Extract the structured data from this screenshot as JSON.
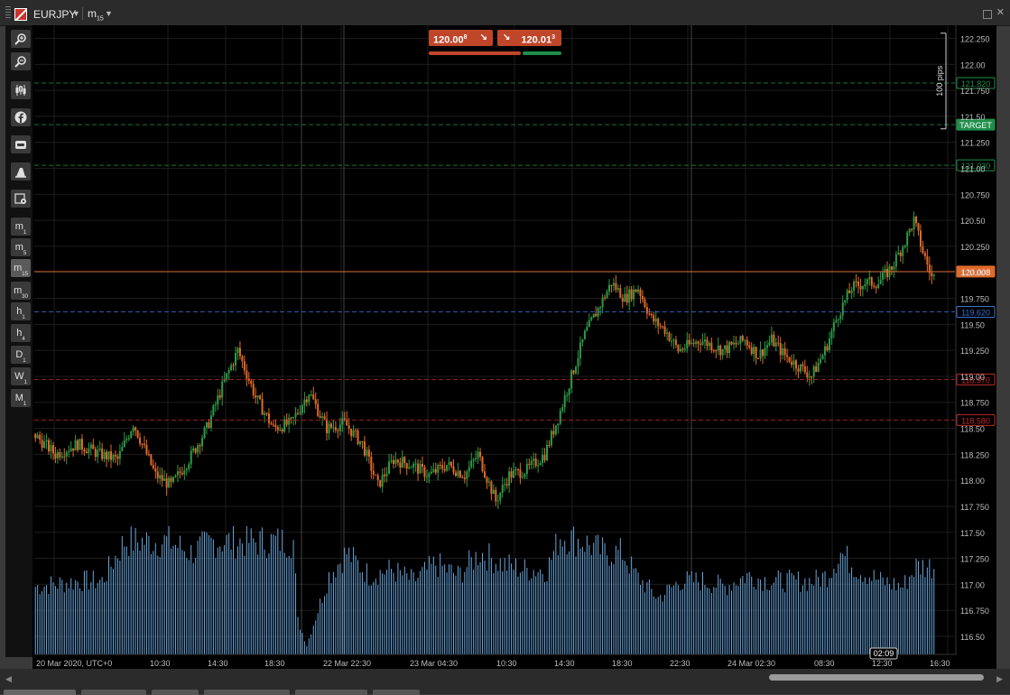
{
  "window": {
    "symbol": "EURJPY",
    "timeframe_main": "m",
    "timeframe_sub": "15"
  },
  "sidebar": {
    "tools": [
      {
        "name": "zoom-in-icon"
      },
      {
        "name": "zoom-out-icon"
      },
      {
        "name": "candlestick-icon"
      },
      {
        "name": "facebook-icon"
      },
      {
        "name": "bot-icon"
      },
      {
        "name": "drawing-icon"
      },
      {
        "name": "settings-icon"
      }
    ],
    "timeframes": [
      {
        "main": "m",
        "sub": "1",
        "active": false
      },
      {
        "main": "m",
        "sub": "5",
        "active": false
      },
      {
        "main": "m",
        "sub": "15",
        "active": true
      },
      {
        "main": "m",
        "sub": "30",
        "active": false
      },
      {
        "main": "h",
        "sub": "1",
        "active": false
      },
      {
        "main": "h",
        "sub": "4",
        "active": false
      },
      {
        "main": "D",
        "sub": "1",
        "active": false
      },
      {
        "main": "W",
        "sub": "1",
        "active": false
      },
      {
        "main": "M",
        "sub": "1",
        "active": false
      }
    ]
  },
  "trade": {
    "sell_price": "120.00",
    "sell_superscript": "8",
    "buy_price": "120.01",
    "buy_superscript": "3",
    "sell_share": 0.7,
    "buy_share": 0.3
  },
  "chart_data": {
    "type": "candlestick",
    "ylim": [
      116.3,
      122.35
    ],
    "y_ticks": [
      "122.250",
      "122.00",
      "121.750",
      "121.50",
      "121.250",
      "121.00",
      "120.750",
      "120.50",
      "120.250",
      "120.00",
      "119.750",
      "119.50",
      "119.250",
      "119.00",
      "118.750",
      "118.50",
      "118.250",
      "118.00",
      "117.750",
      "117.50",
      "117.250",
      "117.00",
      "116.750",
      "116.50"
    ],
    "x_labels": [
      "20 Mar 2020, UTC+0",
      "10:30",
      "14:30",
      "18:30",
      "22 Mar 22:30",
      "23 Mar 04:30",
      "10:30",
      "14:30",
      "18:30",
      "22:30",
      "24 Mar 02:30",
      "08:30",
      "12:30",
      "16:30"
    ],
    "countdown": "02:09",
    "ruler_label": "100 pips",
    "levels": [
      {
        "price": 121.82,
        "label": "121.820",
        "color": "#1f8e4a",
        "style": "dashed"
      },
      {
        "price": 121.42,
        "label": "TARGET",
        "color": "#1f8e4a",
        "style": "dashed"
      },
      {
        "price": 121.03,
        "label": "121.030",
        "color": "#1f8e4a",
        "style": "dashed"
      },
      {
        "price": 120.008,
        "label": "120.008",
        "color": "#e06a2a",
        "style": "solid"
      },
      {
        "price": 119.62,
        "label": "119.620",
        "color": "#3a6fd0",
        "style": "dashed"
      },
      {
        "price": 118.97,
        "label": "118.970",
        "color": "#c0292c",
        "style": "dashed"
      },
      {
        "price": 118.58,
        "label": "118.580",
        "color": "#c0292c",
        "style": "dashed"
      }
    ],
    "series_anchors": [
      [
        0,
        118.45
      ],
      [
        10,
        118.25
      ],
      [
        20,
        118.35
      ],
      [
        30,
        118.25
      ],
      [
        38,
        118.2
      ],
      [
        45,
        118.55
      ],
      [
        55,
        118.05
      ],
      [
        62,
        117.95
      ],
      [
        70,
        118.2
      ],
      [
        78,
        118.5
      ],
      [
        85,
        118.9
      ],
      [
        92,
        119.25
      ],
      [
        100,
        118.8
      ],
      [
        108,
        118.5
      ],
      [
        116,
        118.55
      ],
      [
        124,
        118.85
      ],
      [
        132,
        118.5
      ],
      [
        140,
        118.55
      ],
      [
        148,
        118.35
      ],
      [
        155,
        117.95
      ],
      [
        162,
        118.2
      ],
      [
        170,
        118.15
      ],
      [
        178,
        118.05
      ],
      [
        186,
        118.15
      ],
      [
        194,
        118.05
      ],
      [
        200,
        118.25
      ],
      [
        208,
        117.8
      ],
      [
        214,
        118.05
      ],
      [
        222,
        118.1
      ],
      [
        230,
        118.25
      ],
      [
        236,
        118.6
      ],
      [
        242,
        119.0
      ],
      [
        248,
        119.4
      ],
      [
        254,
        119.65
      ],
      [
        260,
        119.9
      ],
      [
        266,
        119.75
      ],
      [
        272,
        119.85
      ],
      [
        278,
        119.55
      ],
      [
        284,
        119.45
      ],
      [
        290,
        119.25
      ],
      [
        300,
        119.35
      ],
      [
        310,
        119.25
      ],
      [
        320,
        119.35
      ],
      [
        326,
        119.2
      ],
      [
        332,
        119.35
      ],
      [
        338,
        119.2
      ],
      [
        344,
        119.1
      ],
      [
        350,
        119.0
      ],
      [
        356,
        119.25
      ],
      [
        362,
        119.6
      ],
      [
        368,
        119.85
      ],
      [
        374,
        119.9
      ],
      [
        380,
        119.9
      ],
      [
        386,
        120.05
      ],
      [
        392,
        120.3
      ],
      [
        396,
        120.5
      ],
      [
        400,
        120.2
      ],
      [
        404,
        119.95
      ]
    ],
    "volume_anchors": [
      [
        0,
        600
      ],
      [
        20,
        650
      ],
      [
        30,
        650
      ],
      [
        40,
        1000
      ],
      [
        60,
        1000
      ],
      [
        70,
        900
      ],
      [
        80,
        1000
      ],
      [
        100,
        1000
      ],
      [
        116,
        1000
      ],
      [
        118,
        300
      ],
      [
        122,
        80
      ],
      [
        132,
        700
      ],
      [
        140,
        900
      ],
      [
        150,
        700
      ],
      [
        160,
        750
      ],
      [
        170,
        650
      ],
      [
        180,
        800
      ],
      [
        190,
        700
      ],
      [
        200,
        900
      ],
      [
        210,
        800
      ],
      [
        220,
        750
      ],
      [
        230,
        750
      ],
      [
        236,
        1050
      ],
      [
        246,
        1000
      ],
      [
        256,
        900
      ],
      [
        264,
        900
      ],
      [
        270,
        700
      ],
      [
        280,
        500
      ],
      [
        290,
        650
      ],
      [
        300,
        650
      ],
      [
        310,
        600
      ],
      [
        320,
        700
      ],
      [
        330,
        650
      ],
      [
        340,
        650
      ],
      [
        350,
        650
      ],
      [
        356,
        700
      ],
      [
        362,
        900
      ],
      [
        370,
        750
      ],
      [
        380,
        650
      ],
      [
        390,
        600
      ],
      [
        396,
        780
      ],
      [
        400,
        780
      ],
      [
        404,
        780
      ]
    ],
    "volume_max": 1100,
    "candles": 405
  }
}
